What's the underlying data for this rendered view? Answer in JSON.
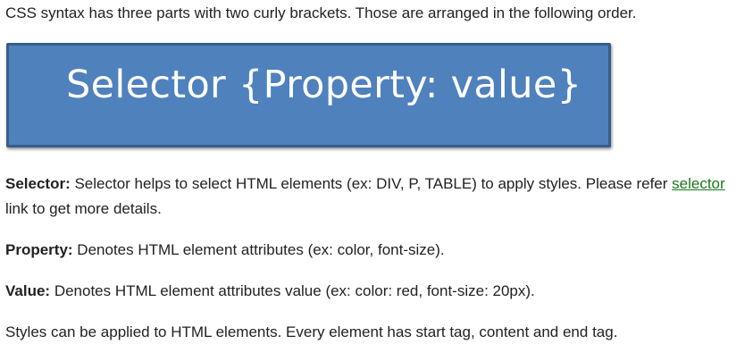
{
  "intro": "CSS syntax has three parts with two curly brackets. Those are arranged in the following order.",
  "syntax_box": {
    "text": "Selector {Property: value}"
  },
  "selector_para": {
    "term": "Selector:",
    "text_before_link": " Selector helps to select HTML elements (ex: DIV, P, TABLE) to apply styles. Please refer ",
    "link_text": "selector",
    "text_after_link": " link to get more details."
  },
  "property_para": {
    "term": "Property:",
    "text": " Denotes HTML element attributes (ex: color, font-size)."
  },
  "value_para": {
    "term": "Value:",
    "text": " Denotes HTML element attributes value (ex: color: red, font-size: 20px)."
  },
  "styles_para": {
    "text": "Styles can be applied to HTML elements. Every element has start tag, content and end tag."
  },
  "colors": {
    "box_fill": "#4f81bd",
    "box_border": "#385d8a",
    "link": "#1a7a1a",
    "text": "#222222"
  }
}
